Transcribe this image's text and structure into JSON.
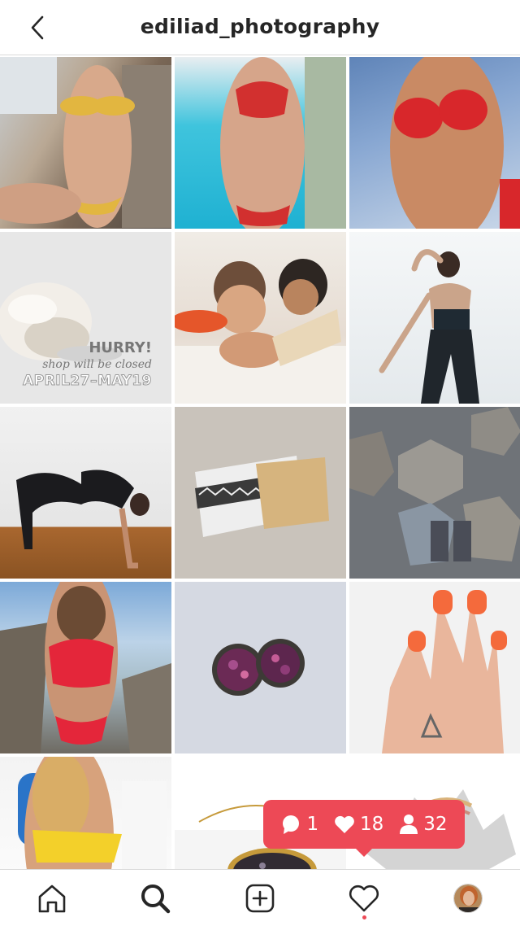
{
  "header": {
    "title": "ediliad_photography",
    "back_icon": "chevron-left-icon"
  },
  "grid": {
    "posts": [
      {
        "name": "post-1"
      },
      {
        "name": "post-2"
      },
      {
        "name": "post-3"
      },
      {
        "name": "post-4",
        "overlay": {
          "title": "HURRY!",
          "subtitle": "shop will be closed",
          "dates": "APRIL27–MAY19"
        }
      },
      {
        "name": "post-5"
      },
      {
        "name": "post-6"
      },
      {
        "name": "post-7"
      },
      {
        "name": "post-8"
      },
      {
        "name": "post-9"
      },
      {
        "name": "post-10"
      },
      {
        "name": "post-11"
      },
      {
        "name": "post-12"
      },
      {
        "name": "post-13"
      },
      {
        "name": "post-14"
      },
      {
        "name": "post-15"
      }
    ]
  },
  "activity_popup": {
    "comments": "1",
    "likes": "18",
    "follows": "32",
    "color": "#ed4956"
  },
  "bottom_nav": {
    "items": [
      "home-icon",
      "search-icon",
      "add-post-icon",
      "heart-icon",
      "profile-avatar"
    ],
    "active": "search-icon",
    "notification_dot_color": "#ed4956"
  }
}
